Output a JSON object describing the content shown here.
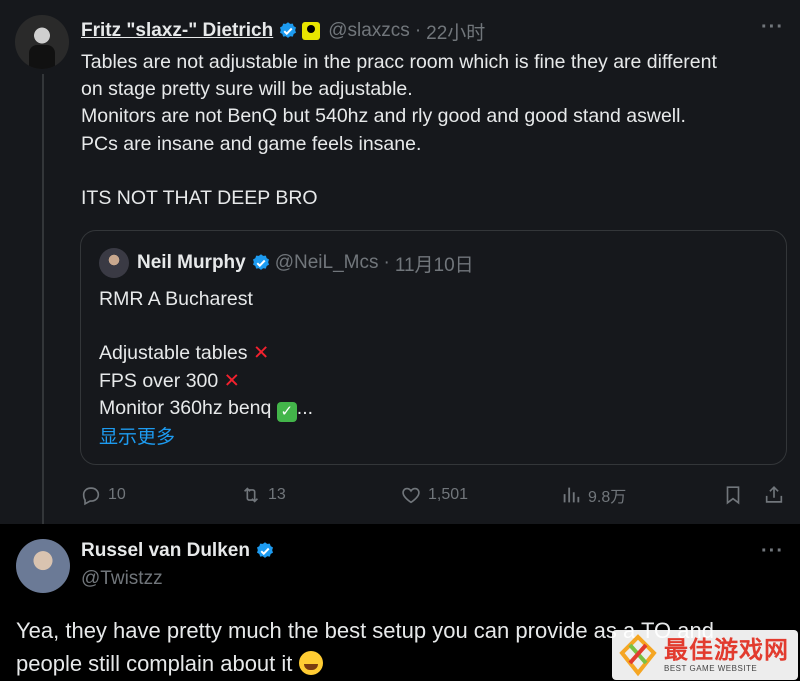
{
  "tweet": {
    "author_name": "Fritz \"slaxz-\" Dietrich",
    "handle": "@slaxzcs",
    "time": "22小时",
    "more": "···",
    "lines": [
      "Tables are not adjustable in the pracc room which is fine they are different",
      "on stage pretty sure will be adjustable.",
      "Monitors are not BenQ but 540hz and rly good and good stand aswell.",
      "PCs are insane and game feels insane.",
      "",
      "ITS NOT THAT DEEP BRO"
    ],
    "quote": {
      "author_name": "Neil Murphy",
      "handle": "@NeiL_Mcs",
      "time": "11月10日",
      "line1": "RMR A Bucharest",
      "line2": "Adjustable tables",
      "line3": "FPS over 300",
      "line4": "Monitor 360hz benq",
      "ellipsis": "...",
      "show_more": "显示更多",
      "cross": "✕",
      "check": "✓"
    },
    "actions": {
      "replies": "10",
      "retweets": "13",
      "likes": "1,501",
      "views": "9.8万"
    }
  },
  "reply": {
    "author_name": "Russel van Dulken",
    "handle": "@Twistzz",
    "more": "···",
    "text": "Yea, they have pretty much the best setup you can provide as a TO and people still complain about it"
  },
  "watermark": {
    "title": "最佳游戏网",
    "subtitle": "BEST GAME WEBSITE"
  },
  "colors": {
    "accent": "#1d9bf0",
    "verified": "#1d9bf0",
    "muted": "#71767b",
    "cross": "#f4212e"
  }
}
